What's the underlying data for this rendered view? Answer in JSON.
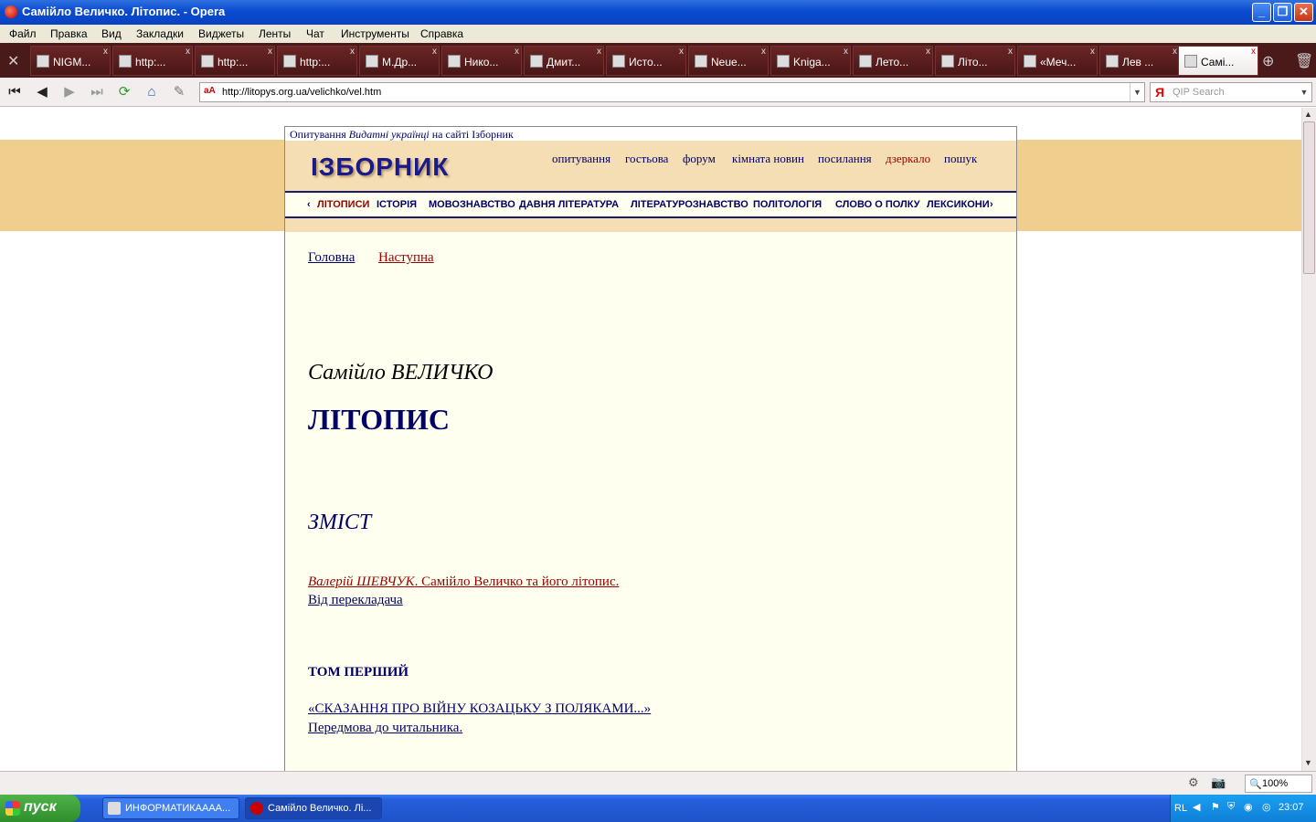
{
  "window": {
    "title": "Самійло Величко. Літопис. - Opera",
    "controls": {
      "minimize": "_",
      "maximize": "❐",
      "close": "✕"
    }
  },
  "menu": [
    "Файл",
    "Правка",
    "Вид",
    "Закладки",
    "Виджеты",
    "Ленты",
    "Чат",
    "Инструменты",
    "Справка"
  ],
  "tabs": [
    {
      "label": "NIGM...",
      "icon": "nigma-icon"
    },
    {
      "label": "http:...",
      "icon": "globe-icon"
    },
    {
      "label": "http:...",
      "icon": "globe-icon"
    },
    {
      "label": "http:...",
      "icon": "globe-icon"
    },
    {
      "label": "М.Др...",
      "icon": "page-icon"
    },
    {
      "label": "Нико...",
      "icon": "buildings-icon"
    },
    {
      "label": "Дмит...",
      "icon": "site-icon"
    },
    {
      "label": "Исто...",
      "icon": "page-icon"
    },
    {
      "label": "Neue...",
      "icon": "page-icon"
    },
    {
      "label": "Kniga...",
      "icon": "kf-icon"
    },
    {
      "label": "Лето...",
      "icon": "kf-icon"
    },
    {
      "label": "Літо...",
      "icon": "site-icon"
    },
    {
      "label": "«Меч...",
      "icon": "book-icon"
    },
    {
      "label": "Лев ...",
      "icon": "page-icon"
    },
    {
      "label": "Самі...",
      "icon": "izbornyk-icon",
      "active": true
    }
  ],
  "tab_close": "x",
  "navbar": {
    "url": "http://litopys.org.ua/velichko/vel.htm",
    "favicon": "aA",
    "search_placeholder": "QIP Search",
    "search_icon": "Я"
  },
  "site": {
    "survey_prefix": "Опитування ",
    "survey_italic": "Видатні українці",
    "survey_suffix": " на сайті Ізборник",
    "logo": "ІЗБОРНИК",
    "topnav": [
      "опитування",
      "гостьова",
      "форум",
      "кімната новин",
      "посилання",
      "дзеркало",
      "пошук"
    ],
    "secnav": [
      "‹",
      "ЛІТОПИСИ",
      "ІСТОРІЯ",
      "МОВОЗНАВСТВО",
      "ДАВНЯ ЛІТЕРАТУРА",
      "ЛІТЕРАТУРОЗНАВСТВО",
      "ПОЛІТОЛОГІЯ",
      "СЛОВО О ПОЛКУ",
      "ЛЕКСИКОНИ",
      "›"
    ]
  },
  "content": {
    "home_link": "Головна",
    "next_link": "Наступна",
    "author": "Самійло ВЕЛИЧКО",
    "title": "ЛІТОПИС",
    "toc": "ЗМІСТ",
    "intro_author": "Валерій ШЕВЧУК",
    "intro_rest": ". Самійло Величко та його літопис.",
    "translator": "Від перекладача",
    "volume": "ТОМ ПЕРШИЙ",
    "tale": "«СКАЗАННЯ ПРО ВІЙНУ КОЗАЦЬКУ З ПОЛЯКАМИ...»",
    "preface": "Передмова до читальника."
  },
  "statusbar": {
    "zoom": "100%"
  },
  "taskbar": {
    "start": "пуск",
    "tasks": [
      {
        "label": "ИНФОРМАТИКАААА...",
        "active": false
      },
      {
        "label": "Самійло Величко. Лі...",
        "active": true
      }
    ],
    "lang": "RL",
    "clock": "23:07"
  },
  "colors": {
    "band": "#f0cf8e",
    "header": "#f5deb3",
    "page_bg": "#fffff0",
    "link_blue": "#000066",
    "link_red": "#990000"
  }
}
